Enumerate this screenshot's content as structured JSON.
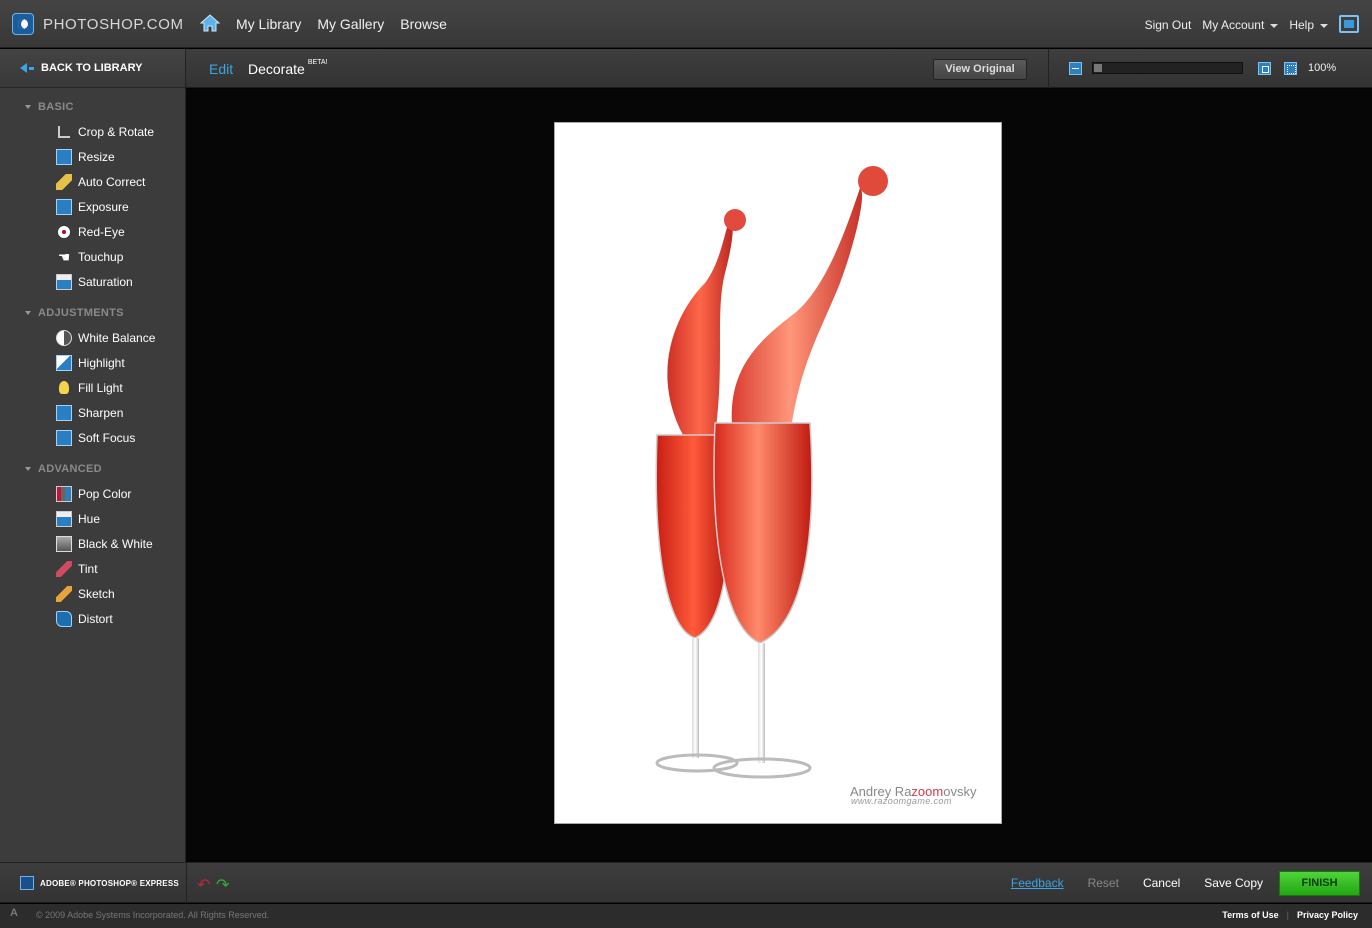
{
  "header": {
    "logo_text": "PHOTOSHOP.COM",
    "nav": [
      "My Library",
      "My Gallery",
      "Browse"
    ],
    "sign_out": "Sign Out",
    "my_account": "My Account",
    "help": "Help"
  },
  "sidebar": {
    "back_label": "BACK TO LIBRARY",
    "sections": [
      {
        "title": "BASIC",
        "items": [
          {
            "label": "Crop & Rotate",
            "icon": "crop-icon"
          },
          {
            "label": "Resize",
            "icon": "resize-icon"
          },
          {
            "label": "Auto Correct",
            "icon": "wand-icon"
          },
          {
            "label": "Exposure",
            "icon": "exposure-icon"
          },
          {
            "label": "Red-Eye",
            "icon": "red-eye-icon"
          },
          {
            "label": "Touchup",
            "icon": "hand-icon"
          },
          {
            "label": "Saturation",
            "icon": "saturation-icon"
          }
        ]
      },
      {
        "title": "ADJUSTMENTS",
        "items": [
          {
            "label": "White Balance",
            "icon": "white-balance-icon"
          },
          {
            "label": "Highlight",
            "icon": "highlight-icon"
          },
          {
            "label": "Fill Light",
            "icon": "bulb-icon"
          },
          {
            "label": "Sharpen",
            "icon": "sharpen-icon"
          },
          {
            "label": "Soft Focus",
            "icon": "soft-focus-icon"
          }
        ]
      },
      {
        "title": "ADVANCED",
        "items": [
          {
            "label": "Pop Color",
            "icon": "pop-color-icon"
          },
          {
            "label": "Hue",
            "icon": "hue-icon"
          },
          {
            "label": "Black & White",
            "icon": "black-white-icon"
          },
          {
            "label": "Tint",
            "icon": "tint-icon"
          },
          {
            "label": "Sketch",
            "icon": "sketch-icon"
          },
          {
            "label": "Distort",
            "icon": "distort-icon"
          }
        ]
      }
    ]
  },
  "editor": {
    "tab_edit": "Edit",
    "tab_decorate": "Decorate",
    "tab_decorate_badge": "BETA!",
    "view_original": "View Original",
    "zoom_level": "100%",
    "zoom_slider_fraction": 0.0
  },
  "photo": {
    "watermark_name_a": "Andrey Ra",
    "watermark_name_b": "zoom",
    "watermark_name_c": "ovsky",
    "watermark_url": "www.razoomgame.com"
  },
  "bottom": {
    "brand": "ADOBE® PHOTOSHOP® EXPRESS",
    "feedback": "Feedback",
    "reset": "Reset",
    "cancel": "Cancel",
    "save_copy": "Save Copy",
    "finish": "FINISH"
  },
  "footer": {
    "copyright": "© 2009 Adobe Systems Incorporated. All Rights Reserved.",
    "terms": "Terms of Use",
    "privacy": "Privacy Policy"
  },
  "colors": {
    "accent_blue": "#3aa5e6",
    "finish_green": "#2fbf1e",
    "wine_red": "#e0352b"
  }
}
